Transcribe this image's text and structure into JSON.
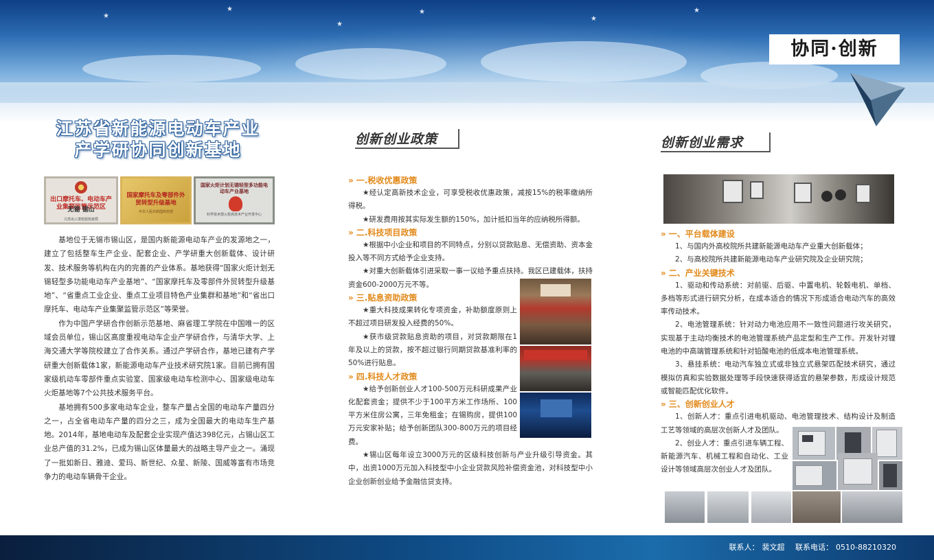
{
  "banner": {
    "slogan": "协同·创新"
  },
  "left": {
    "title_line1": "江苏省新能源电动车产业",
    "title_line2": "产学研协同创新基地",
    "plaques": [
      {
        "line1": "出口摩托车、电动车产业集群监管示范区",
        "line2": "无锡 锡山",
        "line3": "江苏出入境检验检疫局"
      },
      {
        "line1": "国家摩托车及零部件外贸转型升级基地",
        "line2": "中华人民共和国商务部"
      },
      {
        "line1": "国家火炬计划无锡轻型多功能电动车产业基地",
        "line2": "科学技术部火炬高技术产业开发中心"
      }
    ],
    "paragraphs": [
      "基地位于无锡市锡山区，是国内新能源电动车产业的发源地之一，建立了包括整车生产企业、配套企业、产学研重大创新载体、设计研发、技术服务等机构在内的完善的产业体系。基地获得“国家火炬计划无锡轻型多功能电动车产业基地”、“国家摩托车及零部件外贸转型升级基地”、“省重点工业企业、重点工业项目特色产业集群和基地”和“省出口摩托车、电动车产业集聚监管示范区”等荣誉。",
      "作为中国产学研合作创新示范基地、麻省理工学院在中国唯一的区域会员单位，锡山区高度重视电动车企业产学研合作，与清华大学、上海交通大学等院校建立了合作关系。通过产学研合作，基地已建有产学研重大创新载体1家，新能源电动车产业技术研究院1家。目前已拥有国家级机动车零部件重点实验室、国家级电动车检测中心、国家级电动车火炬基地等7个公共技术服务平台。",
      "基地拥有500多家电动车企业，整车产量占全国的电动车产量四分之一，占全省电动车产量的四分之三，成为全国最大的电动车生产基地。2014年，基地电动车及配套企业实现产值达398亿元，占锡山区工业总产值的31.2%，已成为锡山区体量最大的战略主导产业之一。涌现了一批如新日、雅迪、爱玛、新世纪、众星、新陵、国威等富有市场竞争力的电动车辆骨干企业。"
    ]
  },
  "policy": {
    "heading": "创新创业政策",
    "sections": [
      {
        "title": "一.税收优惠政策",
        "paragraphs": [
          "★经认定高新技术企业，可享受税收优惠政策，减按15%的税率缴纳所得税。",
          "★研发费用按其实际发生额的150%，加计抵扣当年的应纳税所得额。"
        ]
      },
      {
        "title": "二.科技项目政策",
        "paragraphs": [
          "★根据中小企业和项目的不同特点，分别以贷款贴息、无偿资助、资本金投入等不同方式给予企业支持。",
          "★对重大创新载体引进采取一事一议给予重点扶持。我区已建载体，扶持资金600-2000万元不等。"
        ]
      },
      {
        "title": "三.贴息资助政策",
        "paragraphs": [
          "★重大科技成果转化专项资金，补助额度原则上不超过项目研发投入经费的50%。",
          "★获市级贷款贴息资助的项目，对贷款期限在1年及以上的贷款，按不超过银行同期贷款基准利率的50%进行贴息。"
        ]
      },
      {
        "title": "四.科技人才政策",
        "paragraphs": [
          "★给予创新创业人才100-500万元科研成果产业化配套资金；提供不少于100平方米工作场所、100平方米住房公寓，三年免租金；在锡购房，提供100万元安家补贴；给予创新团队300-800万元的项目经费。",
          "★锡山区每年设立3000万元的区级科技创新与产业升级引导资金。其中，出资1000万元加入科技型中小企业贷款风险补偿资金池，对科技型中小企业创新创业给予金融信贷支持。"
        ]
      }
    ]
  },
  "demand": {
    "heading": "创新创业需求",
    "sections": [
      {
        "title": "一、平台载体建设",
        "paragraphs": [
          "1、与国内外高校院所共建新能源电动车产业重大创新载体；",
          "2、与高校院所共建新能源电动车产业研究院及企业研究院；"
        ]
      },
      {
        "title": "二、产业关键技术",
        "paragraphs": [
          "1、驱动和传动系统：对前驱、后驱、中置电机、轮毂电机、单档、多档等形式进行研究分析，在成本适合的情况下形成适合电动汽车的高效率传动技术。",
          "2、电池管理系统：针对动力电池应用不一致性问题进行攻关研究，实现基于主动均衡技术的电池管理系统产品定型和生产工作。开发针对锂电池的中高端管理系统和针对铅酸电池的低成本电池管理系统。",
          "3、悬挂系统：电动汽车独立式或非独立式悬架匹配技术研究，通过模拟仿真和实验数据处理等手段快速获得适宜的悬架参数，形成设计规范或智能匹配优化软件。"
        ]
      },
      {
        "title": "三、创新创业人才",
        "paragraphs": [
          "1、创新人才：重点引进电机驱动、电池管理技术、结构设计及制造工艺等领域的高层次创新人才及团队。",
          "2、创业人才：重点引进车辆工程、新能源汽车、机械工程和自动化、工业设计等领域高层次创业人才及团队。"
        ]
      }
    ]
  },
  "footer": {
    "contact_label": "联系人：",
    "contact_name": "裴文超",
    "phone_label": "联系电话：",
    "phone": "0510-88210320"
  },
  "colors": {
    "accent_orange": "#e28a1c",
    "banner_blue": "#2d6db3",
    "footer_navy": "#0f4c86"
  },
  "icons": [
    "chevron-double-right-icon",
    "pyramid-decoration-icon"
  ]
}
